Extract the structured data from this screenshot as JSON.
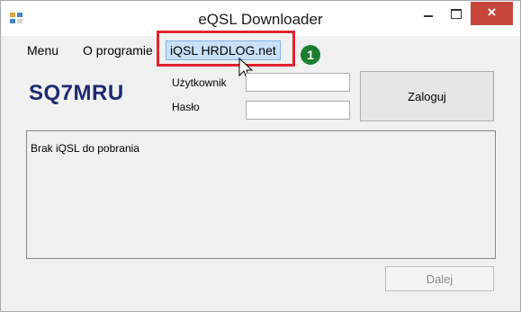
{
  "window": {
    "title": "eQSL Downloader",
    "close_glyph": "×"
  },
  "menu": {
    "items": [
      {
        "label": "Menu"
      },
      {
        "label": "O programie"
      },
      {
        "label": "iQSL HRDLOG.net"
      }
    ],
    "step_badge": "1"
  },
  "header": {
    "callsign": "SQ7MRU",
    "user_label": "Użytkownik",
    "user_value": "",
    "password_label": "Hasło",
    "password_value": "",
    "login_button": "Zaloguj"
  },
  "log": {
    "text": "Brak iQSL do pobrania"
  },
  "footer": {
    "next_button": "Dalej"
  },
  "colors": {
    "callout": "#e0242e",
    "badge": "#1b7e2f",
    "logo": "#1d2b73",
    "close": "#c7463b"
  }
}
